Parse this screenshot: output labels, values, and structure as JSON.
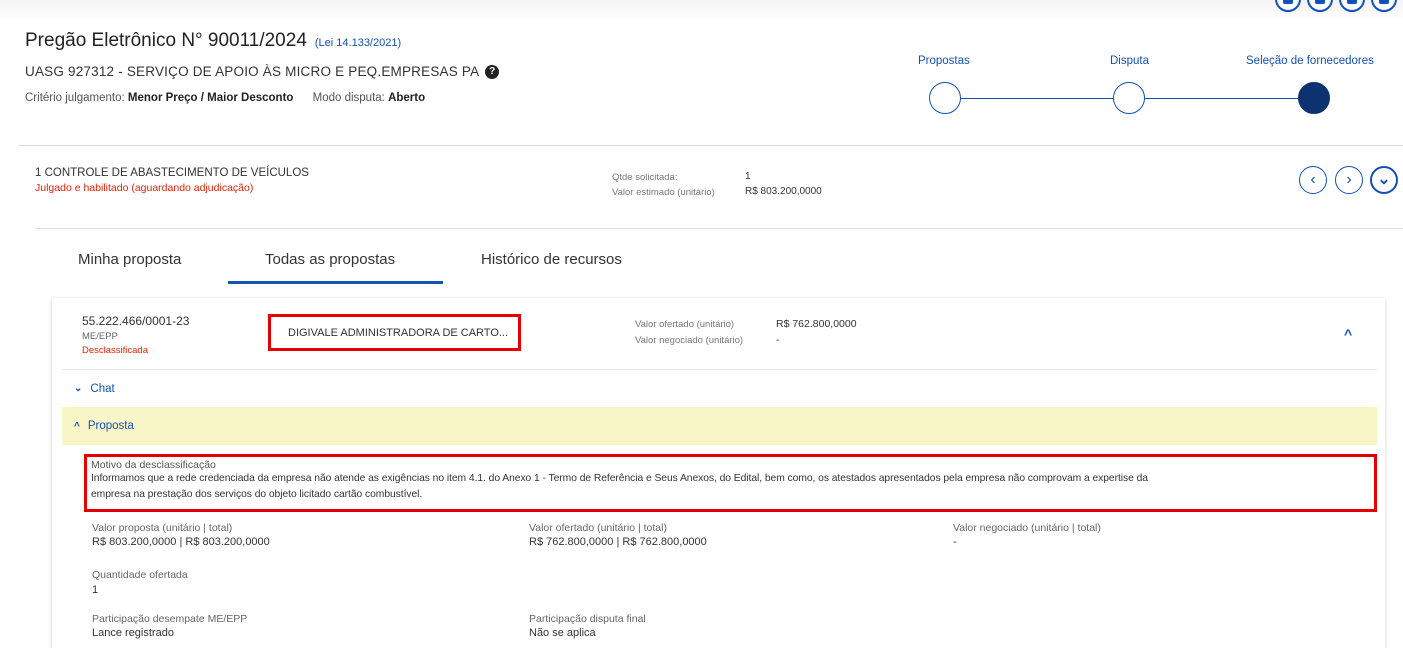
{
  "header": {
    "title": "Pregão Eletrônico N° 90011/2024",
    "law_link": "(Lei 14.133/2021)",
    "uasg": "UASG 927312 - SERVIÇO DE APOIO ÀS MICRO E PEQ.EMPRESAS PA",
    "criteria_label": "Critério julgamento:",
    "criteria_value": "Menor Preço / Maior Desconto",
    "mode_label": "Modo disputa:",
    "mode_value": "Aberto"
  },
  "stepper": {
    "steps": [
      {
        "label": "Propostas",
        "state": "pending"
      },
      {
        "label": "Disputa",
        "state": "pending"
      },
      {
        "label": "Seleção de fornecedores",
        "state": "current"
      }
    ]
  },
  "item": {
    "title": "1  CONTROLE DE ABASTECIMENTO DE VEÍCULOS",
    "status": "Julgado e habilitado (aguardando adjudicação)",
    "qty_label": "Qtde solicitada:",
    "qty_value": "1",
    "est_label": "Valor estimado (unitário)",
    "est_value": "R$ 803.200,0000"
  },
  "tabs": [
    {
      "label": "Minha proposta",
      "active": false
    },
    {
      "label": "Todas as propostas",
      "active": true
    },
    {
      "label": "Histórico de recursos",
      "active": false
    }
  ],
  "proposal": {
    "cnpj": "55.222.466/0001-23",
    "porte": "ME/EPP",
    "status": "Desclassificada",
    "company": "DIGIVALE ADMINISTRADORA DE CARTO...",
    "valor_ofertado_label": "Valor ofertado (unitário)",
    "valor_ofertado_value": "R$ 762.800,0000",
    "valor_negociado_label": "Valor negociado (unitário)",
    "valor_negociado_value": "-",
    "chat_label": "Chat",
    "proposta_label": "Proposta",
    "motivo_label": "Motivo da desclassificação",
    "motivo_line1": "Informamos que a rede credenciada da empresa não atende as exigências no item 4.1. do Anexo 1 - Termo de Referência e Seus Anexos, do Edital, bem como, os atestados apresentados pela empresa não comprovam a expertise da",
    "motivo_line2": "empresa na prestação dos serviços do objeto licitado cartão combustível.",
    "fields": {
      "vp_label": "Valor proposta (unitário | total)",
      "vp_value": "R$ 803.200,0000   |   R$ 803.200,0000",
      "vo_label": "Valor ofertado (unitário | total)",
      "vo_value": "R$ 762.800,0000   |   R$ 762.800,0000",
      "vn_label": "Valor negociado (unitário | total)",
      "vn_value": "-",
      "qo_label": "Quantidade ofertada",
      "qo_value": "1",
      "pd_label": "Participação desempate ME/EPP",
      "pd_value": "Lance registrado",
      "pdf_label": "Participação disputa final",
      "pdf_value": "Não se aplica"
    }
  },
  "icons": {
    "prev": "‹",
    "next": "›",
    "expand": "⌄",
    "collapse": "^",
    "chat_chev": "⌄",
    "proposta_chev": "^",
    "help": "?"
  },
  "colors": {
    "primary": "#1351b4",
    "danger": "#e52207",
    "highlight_border": "#e50000",
    "proposta_bg": "#f8f5c6",
    "step_done": "#0c326f"
  }
}
